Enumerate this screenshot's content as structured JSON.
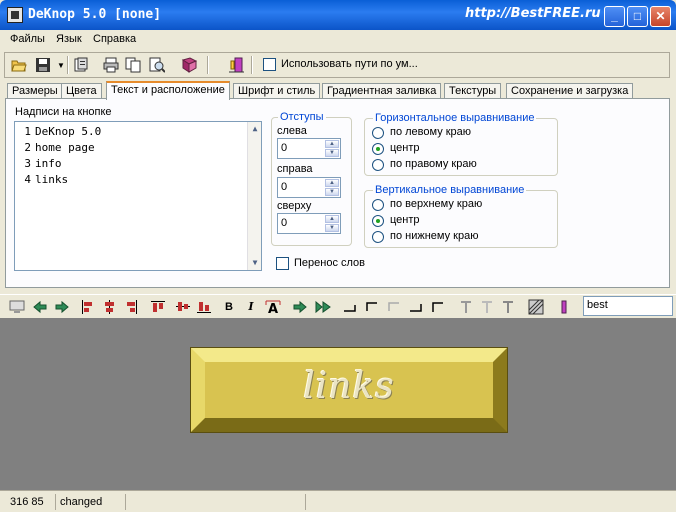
{
  "window": {
    "title": "DeKnop 5.0 [none]",
    "watermark": "http://BestFREE.ru",
    "minimize": "_",
    "maximize": "□",
    "close": "✕"
  },
  "menu": [
    "Файлы",
    "Язык",
    "Справка"
  ],
  "toolbar": {
    "use_paths_label": "Использовать пути по ум...",
    "use_paths_checked": false
  },
  "tabs": [
    {
      "label": "Размеры",
      "active": false
    },
    {
      "label": "Цвета",
      "active": false
    },
    {
      "label": "Текст и расположение",
      "active": true
    },
    {
      "label": "Шрифт и стиль",
      "active": false
    },
    {
      "label": "Градиентная заливка",
      "active": false
    },
    {
      "label": "Текстуры",
      "active": false
    },
    {
      "label": "Сохранение и загрузка",
      "active": false
    }
  ],
  "text_panel": {
    "label": "Надписи на кнопке",
    "line_numbers": [
      "1",
      "2",
      "3",
      "4"
    ],
    "lines": [
      "DeKnop 5.0",
      "home page",
      "info",
      "links"
    ]
  },
  "margins": {
    "title": "Отступы",
    "left_label": "слева",
    "left_value": "0",
    "right_label": "справа",
    "right_value": "0",
    "top_label": "сверху",
    "top_value": "0"
  },
  "halign": {
    "title": "Горизонтальное выравнивание",
    "options": [
      "по левому краю",
      "центр",
      "по правому краю"
    ],
    "selected": "центр"
  },
  "valign": {
    "title": "Вертикальное выравнивание",
    "options": [
      "по верхнему краю",
      "центр",
      "по нижнему краю"
    ],
    "selected": "центр"
  },
  "word_wrap": {
    "label": "Перенос слов",
    "checked": false
  },
  "format_bar": {
    "bold": "B",
    "italic": "I",
    "font_name": "best"
  },
  "preview": {
    "text": "links",
    "color": "#c8b43a"
  },
  "status": {
    "coords": "316 85",
    "state": "changed"
  }
}
